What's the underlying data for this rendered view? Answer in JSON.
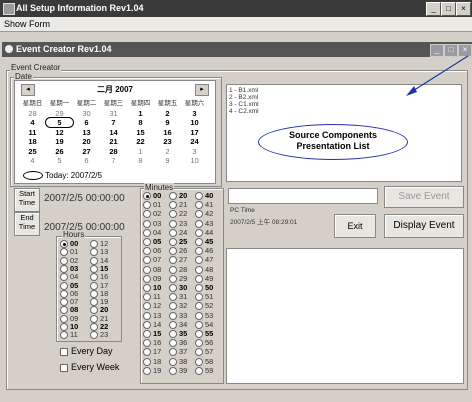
{
  "app": {
    "title": "All Setup Information Rev1.04"
  },
  "menu": {
    "item": "Show Form"
  },
  "dialog": {
    "title": "Event Creator Rev1.04"
  },
  "event_creator": {
    "group_label": "Event Creator",
    "date_label": "Date",
    "calendar": {
      "month": "二月 2007",
      "prev": "◂",
      "next": "▸",
      "weekday_headers": [
        "星期日",
        "星期一",
        "星期二",
        "星期三",
        "星期四",
        "星期五",
        "星期六"
      ],
      "weeks": [
        [
          "28",
          "29",
          "30",
          "31",
          "1",
          "2",
          "3"
        ],
        [
          "4",
          "5",
          "6",
          "7",
          "8",
          "9",
          "10"
        ],
        [
          "11",
          "12",
          "13",
          "14",
          "15",
          "16",
          "17"
        ],
        [
          "18",
          "19",
          "20",
          "21",
          "22",
          "23",
          "24"
        ],
        [
          "25",
          "26",
          "27",
          "28",
          "1",
          "2",
          "3"
        ],
        [
          "4",
          "5",
          "6",
          "7",
          "8",
          "9",
          "10"
        ]
      ],
      "today_label": "Today: 2007/2/5"
    },
    "start_time": {
      "button": "Start Time",
      "value": "2007/2/5 00:00:00"
    },
    "end_time": {
      "button": "End Time",
      "value": "2007/2/5 00:00:00"
    },
    "hours": {
      "label": "Hours",
      "items": [
        "00",
        "12",
        "01",
        "13",
        "02",
        "14",
        "03",
        "15",
        "04",
        "16",
        "05",
        "17",
        "06",
        "18",
        "07",
        "19",
        "08",
        "20",
        "09",
        "21",
        "10",
        "22",
        "11",
        "23"
      ],
      "selected": "00"
    },
    "minutes": {
      "label": "Minutes",
      "items": [
        "00",
        "20",
        "40",
        "01",
        "21",
        "41",
        "02",
        "22",
        "42",
        "03",
        "23",
        "43",
        "04",
        "24",
        "44",
        "05",
        "25",
        "45",
        "06",
        "26",
        "46",
        "07",
        "27",
        "47",
        "08",
        "28",
        "48",
        "09",
        "29",
        "49",
        "10",
        "30",
        "50",
        "11",
        "31",
        "51",
        "12",
        "32",
        "52",
        "13",
        "33",
        "53",
        "14",
        "34",
        "54",
        "15",
        "35",
        "55",
        "16",
        "36",
        "56",
        "17",
        "37",
        "57",
        "18",
        "38",
        "58",
        "19",
        "39",
        "59"
      ],
      "selected": "00"
    },
    "every_day": "Every Day",
    "every_week": "Every Week"
  },
  "source_list": {
    "items": [
      "1 - B1.xml",
      "2 - B2.xml",
      "3 - C1.xml",
      "4 - C2.xml"
    ]
  },
  "annotation": {
    "line1": "Source Components",
    "line2": "Presentation List"
  },
  "pc_time": {
    "label": "PC Time",
    "value": "2007/2/5 上午 08:29:01"
  },
  "buttons": {
    "save_event": "Save Event",
    "exit": "Exit",
    "display_event": "Display Event"
  },
  "colors": {
    "annotation": "#2233aa",
    "titlebar": "#3a3a3a"
  }
}
